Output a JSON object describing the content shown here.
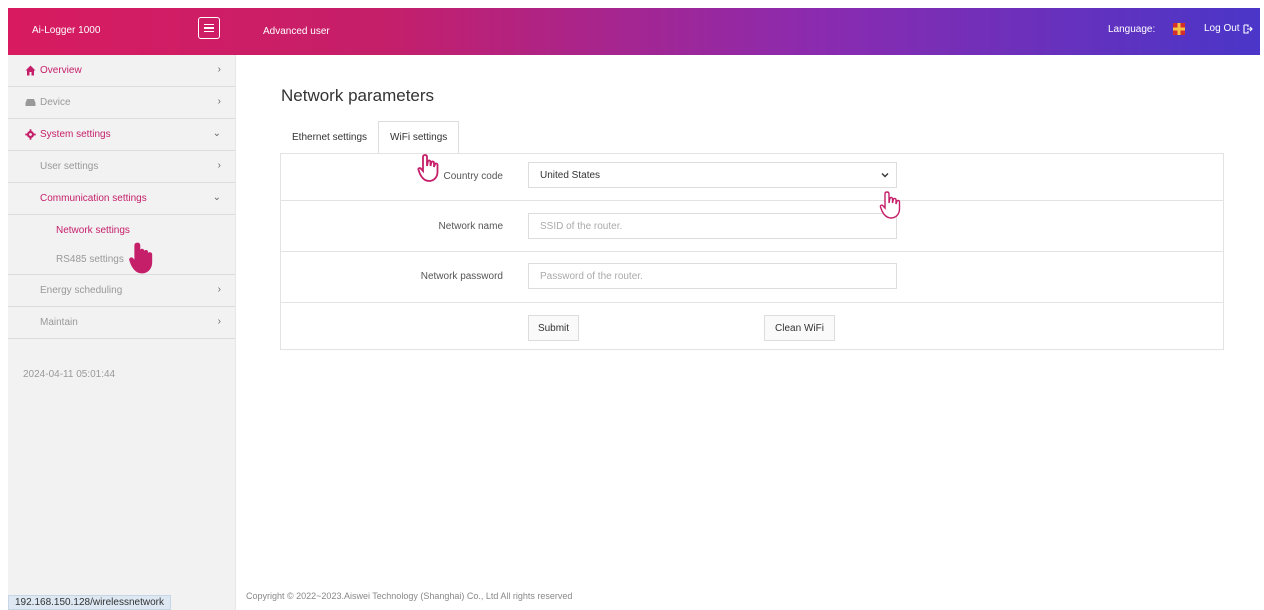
{
  "header": {
    "brand": "Ai-Logger 1000",
    "role": "Advanced user",
    "language_label": "Language:",
    "logout_label": "Log Out"
  },
  "sidebar": {
    "items": [
      {
        "label": "Overview",
        "icon": "home-icon"
      },
      {
        "label": "Device",
        "icon": "device-icon"
      },
      {
        "label": "System settings",
        "icon": "gear-icon"
      },
      {
        "label": "User settings"
      },
      {
        "label": "Communication settings"
      },
      {
        "label": "Network settings"
      },
      {
        "label": "RS485 settings"
      },
      {
        "label": "Energy scheduling"
      },
      {
        "label": "Maintain"
      }
    ],
    "timestamp": "2024-04-11 05:01:44"
  },
  "main": {
    "title": "Network parameters",
    "tabs": [
      {
        "label": "Ethernet settings"
      },
      {
        "label": "WiFi settings"
      }
    ],
    "form": {
      "country_label": "Country code",
      "country_value": "United States",
      "network_name_label": "Network name",
      "network_name_placeholder": "SSID of the router.",
      "network_password_label": "Network password",
      "network_password_placeholder": "Password of the router.",
      "submit_label": "Submit",
      "clean_label": "Clean WiFi"
    }
  },
  "footer": {
    "copyright": "Copyright © 2022~2023.Aiswei Technology (Shanghai) Co., Ltd All rights reserved"
  },
  "status_bar": {
    "url": "192.168.150.128/wirelessnetwork"
  },
  "colors": {
    "accent": "#c51f6a",
    "header_gradient_start": "#d81b60",
    "header_gradient_end": "#4a36c8"
  }
}
